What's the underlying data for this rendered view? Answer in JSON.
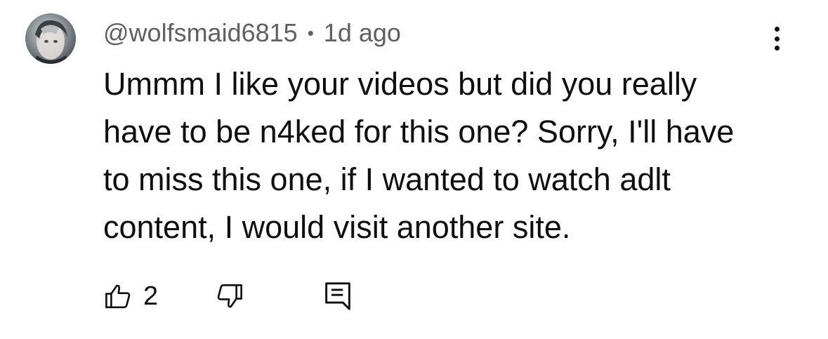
{
  "comment": {
    "author_handle": "@wolfsmaid6815",
    "separator": "•",
    "timestamp": "1d ago",
    "text": "Ummm I like your videos but did you really have to be n4ked for this one? Sorry, I'll have to miss this one, if I wanted to watch adlt content, I would visit another site.",
    "like_count": "2",
    "icons": {
      "avatar": "avatar",
      "more": "more-vertical-icon",
      "like": "thumbs-up-icon",
      "dislike": "thumbs-down-icon",
      "reply": "reply-comment-icon"
    }
  }
}
